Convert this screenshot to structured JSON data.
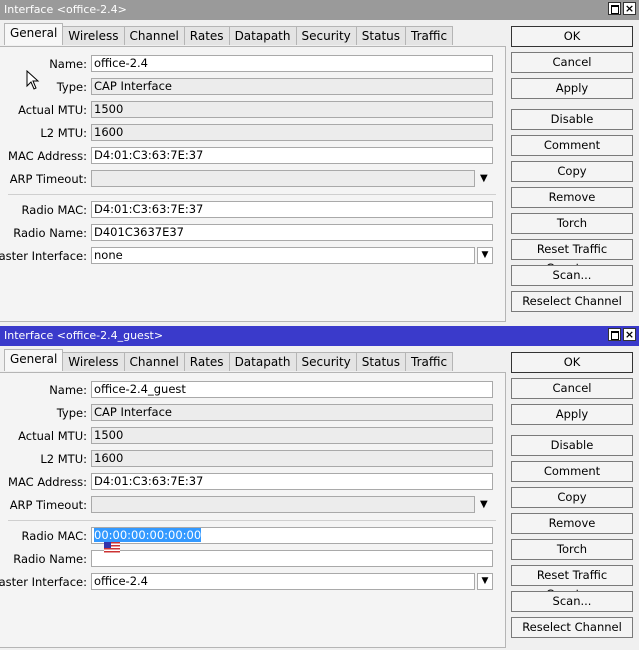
{
  "windows": [
    {
      "title": "Interface <office-2.4>",
      "tabs": [
        "General",
        "Wireless",
        "Channel",
        "Rates",
        "Datapath",
        "Security",
        "Status",
        "Traffic"
      ],
      "active_tab": "General",
      "fields": {
        "name": {
          "label": "Name:",
          "value": "office-2.4"
        },
        "type": {
          "label": "Type:",
          "value": "CAP Interface"
        },
        "actual_mtu": {
          "label": "Actual MTU:",
          "value": "1500"
        },
        "l2_mtu": {
          "label": "L2 MTU:",
          "value": "1600"
        },
        "mac_address": {
          "label": "MAC Address:",
          "value": "D4:01:C3:63:7E:37"
        },
        "arp_timeout": {
          "label": "ARP Timeout:",
          "value": ""
        },
        "radio_mac": {
          "label": "Radio MAC:",
          "value": "D4:01:C3:63:7E:37"
        },
        "radio_name": {
          "label": "Radio Name:",
          "value": "D401C3637E37"
        },
        "master_interface": {
          "label": "Master Interface:",
          "value": "none"
        }
      },
      "buttons": [
        "OK",
        "Cancel",
        "Apply",
        "Disable",
        "Comment",
        "Copy",
        "Remove",
        "Torch",
        "Reset Traffic Counters",
        "Scan...",
        "Reselect Channel"
      ]
    },
    {
      "title": "Interface <office-2.4_guest>",
      "tabs": [
        "General",
        "Wireless",
        "Channel",
        "Rates",
        "Datapath",
        "Security",
        "Status",
        "Traffic"
      ],
      "active_tab": "General",
      "fields": {
        "name": {
          "label": "Name:",
          "value": "office-2.4_guest"
        },
        "type": {
          "label": "Type:",
          "value": "CAP Interface"
        },
        "actual_mtu": {
          "label": "Actual MTU:",
          "value": "1500"
        },
        "l2_mtu": {
          "label": "L2 MTU:",
          "value": "1600"
        },
        "mac_address": {
          "label": "MAC Address:",
          "value": "D4:01:C3:63:7E:37"
        },
        "arp_timeout": {
          "label": "ARP Timeout:",
          "value": ""
        },
        "radio_mac": {
          "label": "Radio MAC:",
          "value": "00:00:00:00:00:00"
        },
        "radio_name": {
          "label": "Radio Name:",
          "value": ""
        },
        "master_interface": {
          "label": "Master Interface:",
          "value": "office-2.4"
        }
      },
      "buttons": [
        "OK",
        "Cancel",
        "Apply",
        "Disable",
        "Comment",
        "Copy",
        "Remove",
        "Torch",
        "Reset Traffic Counters",
        "Scan...",
        "Reselect Channel"
      ]
    }
  ],
  "colors": {
    "active_title": "#3a3acb",
    "inactive_title": "#9a9a9a",
    "selection": "#3399ff"
  },
  "icons": [
    "maximize-icon",
    "close-icon",
    "dropdown-arrow-icon",
    "mouse-cursor-icon",
    "us-flag-icon"
  ]
}
